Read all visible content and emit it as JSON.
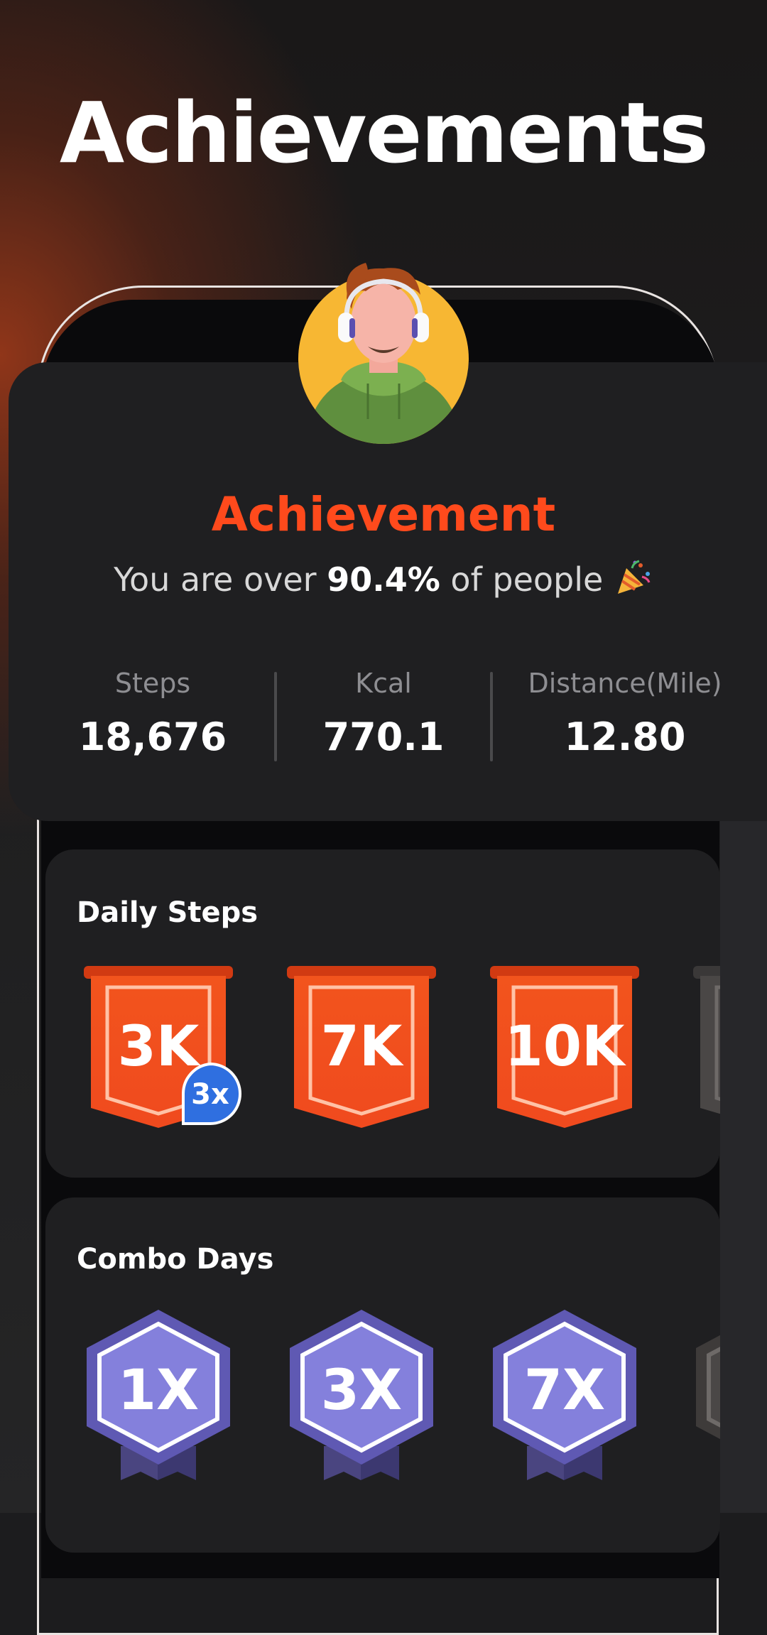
{
  "page": {
    "headline": "Achievements"
  },
  "summary": {
    "title": "Achievement",
    "subtitle_prefix": "You are over",
    "subtitle_percent": "90.4%",
    "subtitle_suffix": "of people",
    "subtitle_emoji_icon": "party-popper-icon",
    "avatar_icon": "user-avatar-headphones"
  },
  "stats": [
    {
      "label": "Steps",
      "value": "18,676"
    },
    {
      "label": "Kcal",
      "value": "770.1"
    },
    {
      "label": "Distance(Mile)",
      "value": "12.80"
    }
  ],
  "daily_steps": {
    "title": "Daily Steps",
    "badges": [
      {
        "label": "3K",
        "multiplier": "3x",
        "state": "earned"
      },
      {
        "label": "7K",
        "state": "earned"
      },
      {
        "label": "10K",
        "state": "earned"
      },
      {
        "label": "",
        "state": "locked"
      }
    ]
  },
  "combo_days": {
    "title": "Combo Days",
    "badges": [
      {
        "label": "1X",
        "state": "earned"
      },
      {
        "label": "3X",
        "state": "earned"
      },
      {
        "label": "7X",
        "state": "earned"
      },
      {
        "label": "",
        "state": "locked"
      }
    ]
  },
  "colors": {
    "accent": "#ff4a1c",
    "badge_orange": "#f0521e",
    "badge_purple": "#7f78d6",
    "multiplier_blue": "#2f6fe0"
  }
}
